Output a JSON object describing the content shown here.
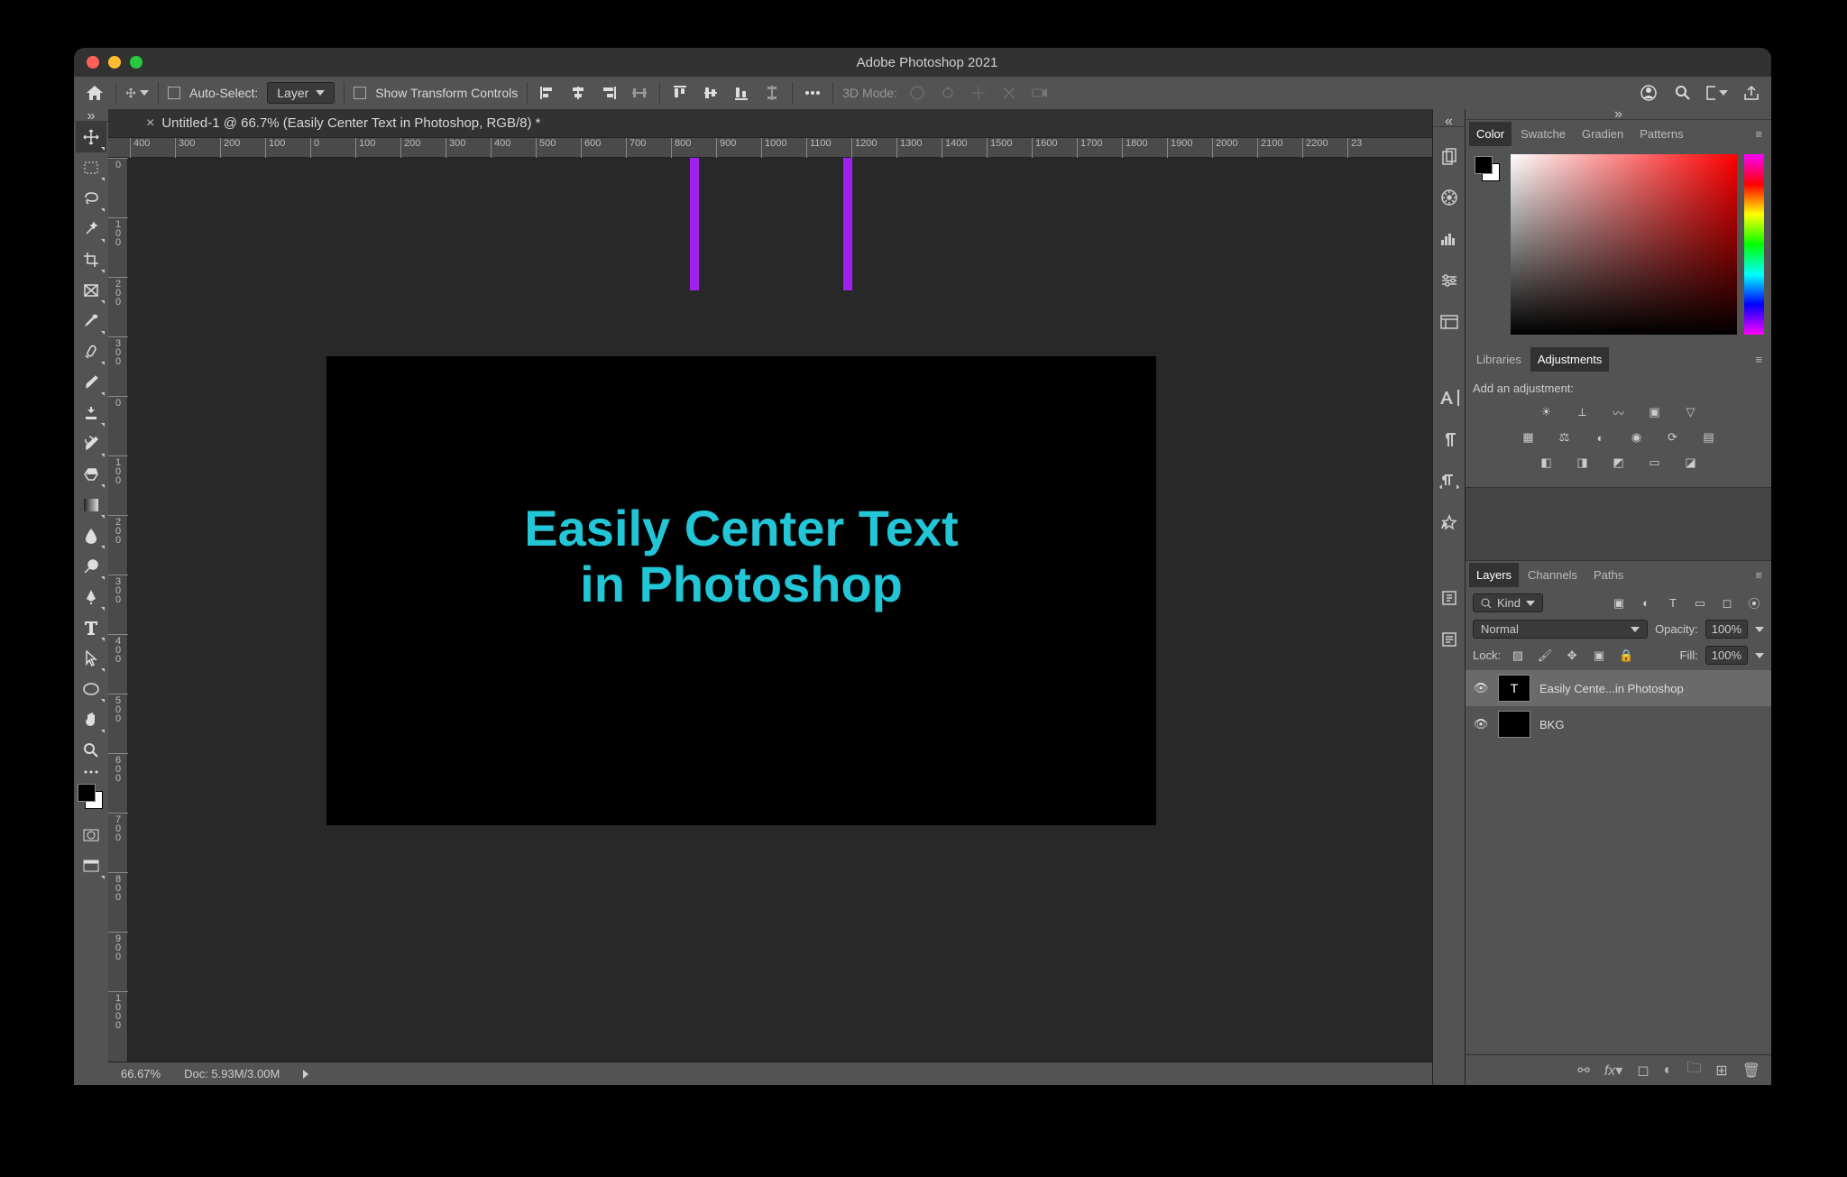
{
  "title": "Adobe Photoshop 2021",
  "options": {
    "auto_select_label": "Auto-Select:",
    "auto_select_target": "Layer",
    "show_transform_label": "Show Transform Controls",
    "threeD_label": "3D Mode:"
  },
  "document_tab": "Untitled-1 @ 66.7% (Easily Center Text in Photoshop, RGB/8) *",
  "ruler_h": [
    "400",
    "300",
    "200",
    "100",
    "0",
    "100",
    "200",
    "300",
    "400",
    "500",
    "600",
    "700",
    "800",
    "900",
    "1000",
    "1100",
    "1200",
    "1300",
    "1400",
    "1500",
    "1600",
    "1700",
    "1800",
    "1900",
    "2000",
    "2100",
    "2200",
    "23"
  ],
  "ruler_v": [
    "0",
    "1 0 0",
    "2 0 0",
    "3 0 0",
    "0",
    "1 0 0",
    "2 0 0",
    "3 0 0",
    "4 0 0",
    "5 0 0",
    "6 0 0",
    "7 0 0",
    "8 0 0",
    "9 0 0",
    "1 0 0 0"
  ],
  "canvas_text_line1": "Easily Center Text",
  "canvas_text_line2": "in Photoshop",
  "panels": {
    "color_tabs": [
      "Color",
      "Swatche",
      "Gradien",
      "Patterns"
    ],
    "lib_tabs": [
      "Libraries",
      "Adjustments"
    ],
    "adjust_hint": "Add an adjustment:",
    "layer_tabs": [
      "Layers",
      "Channels",
      "Paths"
    ],
    "filter_label": "Kind",
    "blend_mode": "Normal",
    "opacity_label": "Opacity:",
    "opacity_value": "100%",
    "lock_label": "Lock:",
    "fill_label": "Fill:",
    "fill_value": "100%",
    "layers": [
      {
        "name": "Easily Cente...in Photoshop",
        "type": "T"
      },
      {
        "name": "BKG",
        "type": "bg"
      }
    ]
  },
  "status": {
    "zoom": "66.67%",
    "doc": "Doc: 5.93M/3.00M"
  }
}
